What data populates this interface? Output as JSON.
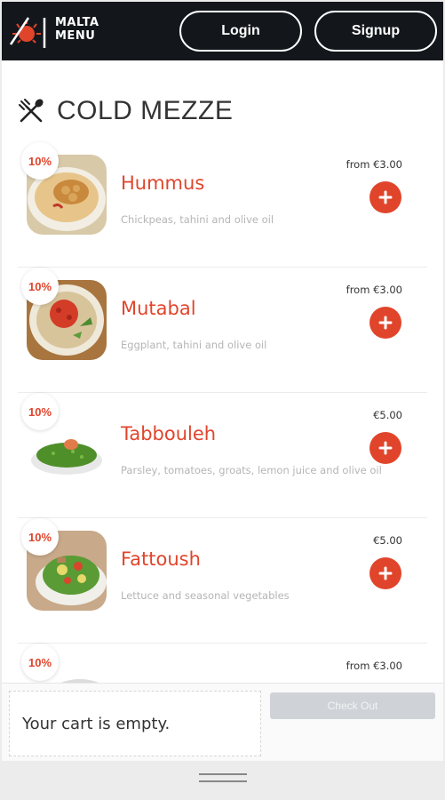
{
  "header": {
    "logo_line1": "MALTA",
    "logo_line2": "MENU",
    "login_label": "Login",
    "signup_label": "Signup"
  },
  "section": {
    "title": "COLD MEZZE",
    "icon": "utensils-icon"
  },
  "items": [
    {
      "badge": "10%",
      "name": "Hummus",
      "description": "Chickpeas, tahini and olive oil",
      "price": "from €3.00"
    },
    {
      "badge": "10%",
      "name": "Mutabal",
      "description": "Eggplant, tahini and olive oil",
      "price": "from €3.00"
    },
    {
      "badge": "10%",
      "name": "Tabbouleh",
      "description": "Parsley, tomatoes, groats, lemon juice and olive oil",
      "price": "€5.00"
    },
    {
      "badge": "10%",
      "name": "Fattoush",
      "description": "Lettuce and seasonal vegetables",
      "price": "€5.00"
    },
    {
      "badge": "10%",
      "name": "",
      "description": "",
      "price": "from €3.00"
    }
  ],
  "cart": {
    "empty_text": "Your cart is empty.",
    "checkout_label": "Check Out"
  },
  "colors": {
    "accent": "#e0452b",
    "header_bg": "#13171c"
  }
}
